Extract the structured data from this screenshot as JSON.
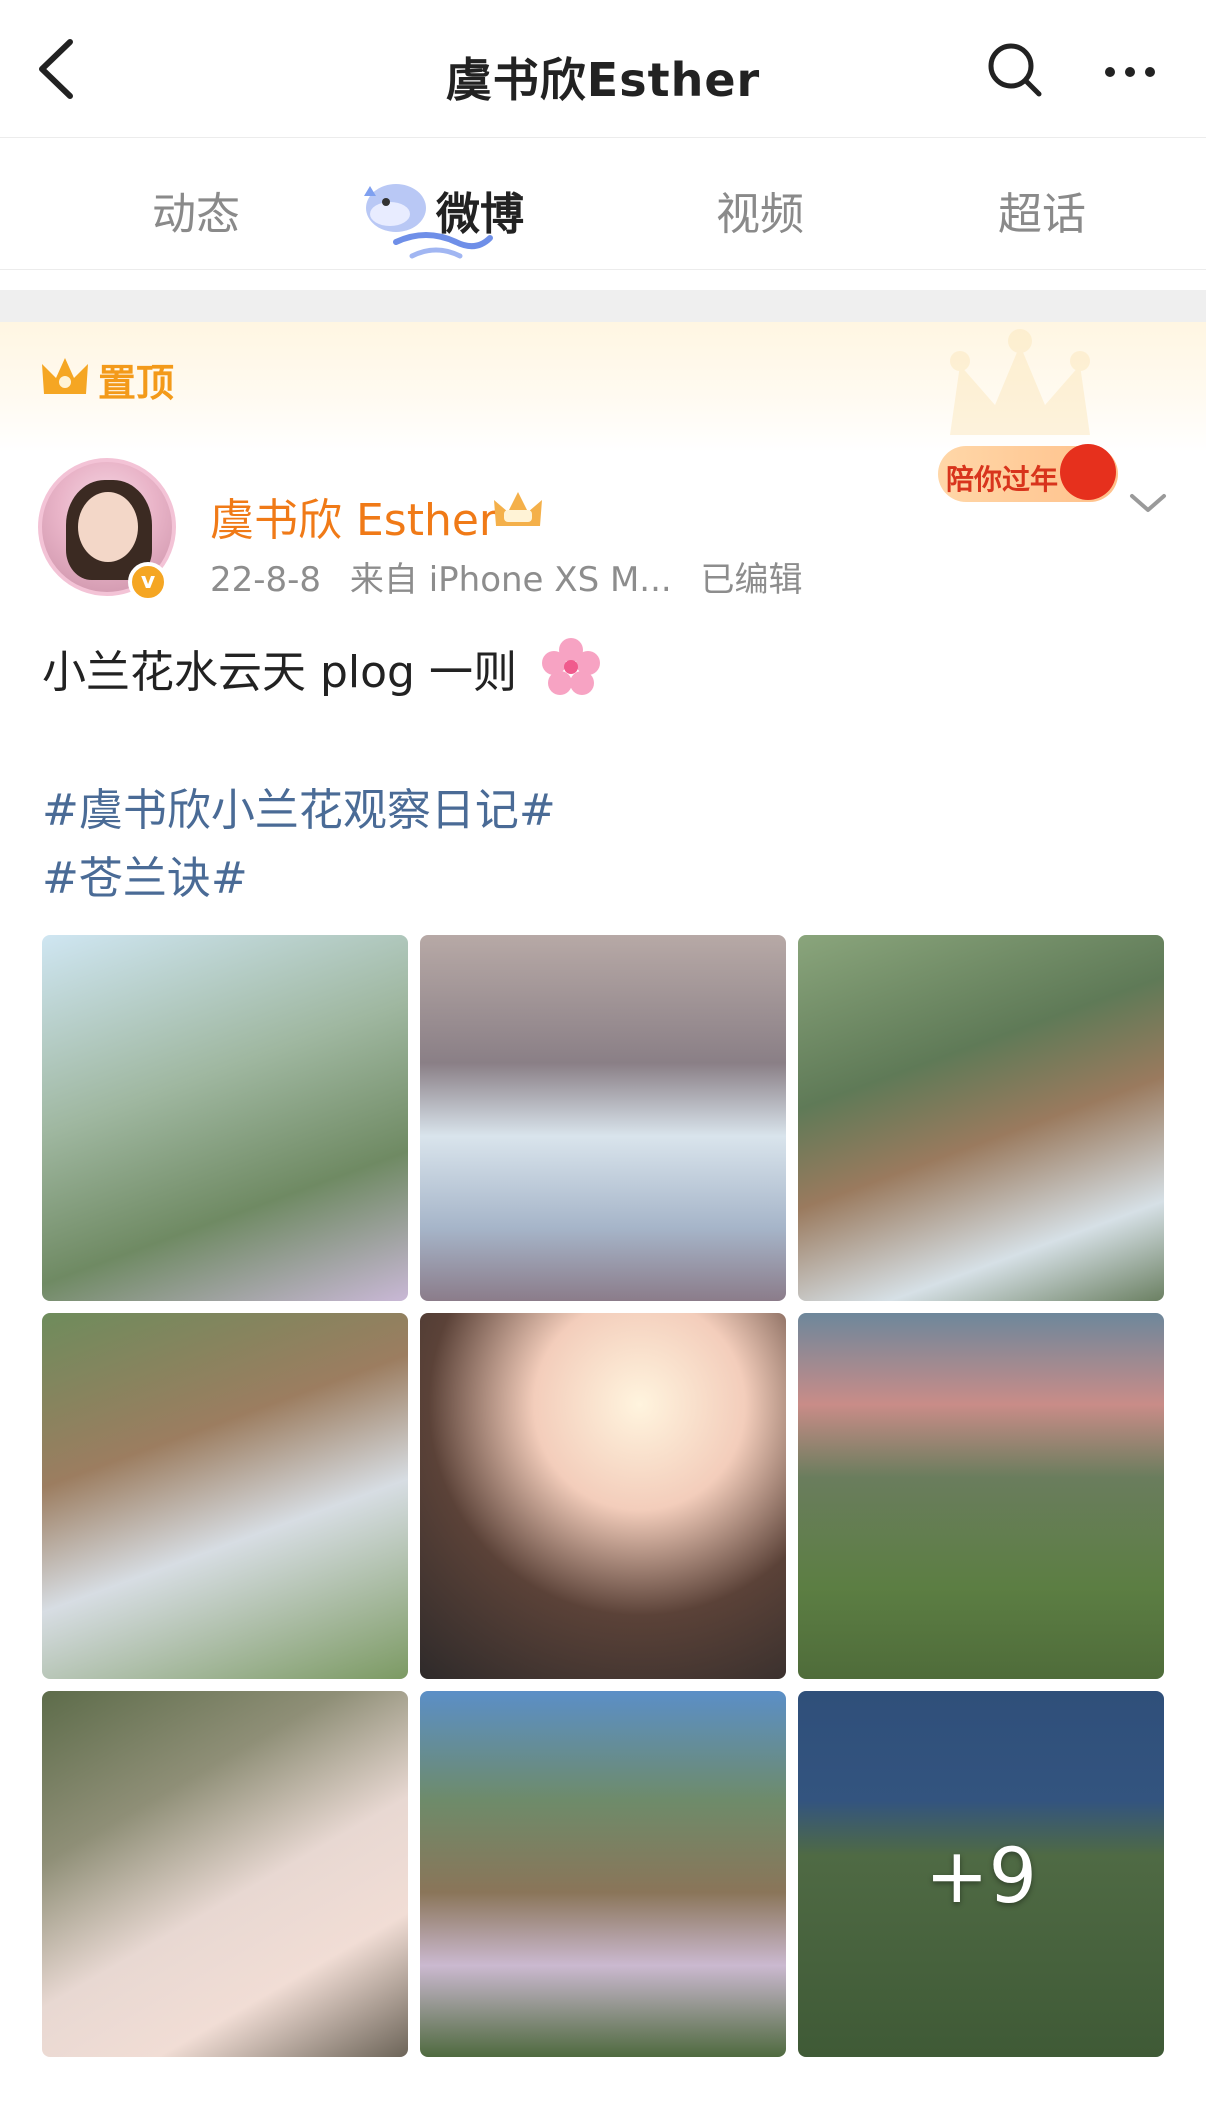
{
  "header": {
    "title": "虞书欣Esther",
    "back_icon": "back-arrow-icon",
    "search_icon": "search-icon",
    "more_icon": "more-dots-icon"
  },
  "tabs": [
    {
      "label": "动态",
      "active": false
    },
    {
      "label": "微博",
      "active": true
    },
    {
      "label": "视频",
      "active": false
    },
    {
      "label": "超话",
      "active": false
    }
  ],
  "pinned": {
    "label": "置顶",
    "icon": "crown-icon"
  },
  "post": {
    "author": "虞书欣 Esther",
    "date": "22-8-8",
    "source": "来自 iPhone XS M...",
    "edited": "已编辑",
    "badge": "陪你过年",
    "text": "小兰花水云天 plog 一则",
    "hashtags": [
      "#虞书欣小兰花观察日记#",
      "#苍兰诀#"
    ],
    "more_images": "+9"
  },
  "colors": {
    "accent_orange": "#f07a17",
    "hashtag_blue": "#4a6b96",
    "pin_gold": "#f39a1a"
  }
}
